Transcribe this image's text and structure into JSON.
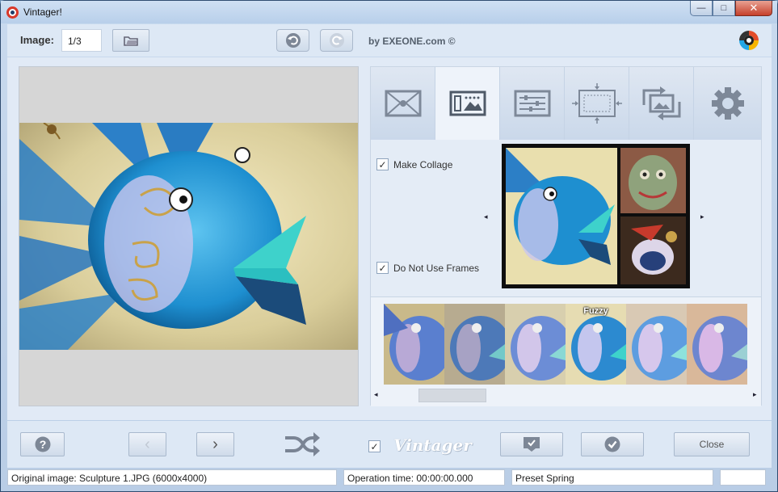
{
  "window": {
    "title": "Vintager!",
    "minimize": "—",
    "maximize": "□",
    "close": "✕"
  },
  "toolbar": {
    "image_label": "Image:",
    "image_value": "1/3",
    "brand_by": "by",
    "brand_name": "EXEONE",
    "brand_suffix": ".com ©"
  },
  "tabs": [
    {
      "name": "frames",
      "icon": "envelope-frame-icon",
      "active": false
    },
    {
      "name": "collage",
      "icon": "collage-icon",
      "active": true
    },
    {
      "name": "adjustments",
      "icon": "sliders-icon",
      "active": false
    },
    {
      "name": "resize",
      "icon": "resize-icon",
      "active": false
    },
    {
      "name": "rotate",
      "icon": "rotate-image-icon",
      "active": false
    },
    {
      "name": "settings",
      "icon": "gear-icon",
      "active": false
    }
  ],
  "collage_options": {
    "make_collage_label": "Make Collage",
    "make_collage_checked": true,
    "no_frames_label": "Do Not Use Frames",
    "no_frames_checked": true,
    "prev_arrow": "◂",
    "next_arrow": "▸"
  },
  "filters": [
    {
      "label": ""
    },
    {
      "label": ""
    },
    {
      "label": ""
    },
    {
      "label": "Fuzzy"
    },
    {
      "label": ""
    },
    {
      "label": ""
    }
  ],
  "scroll": {
    "left": "◂",
    "right": "▸"
  },
  "bottom": {
    "help": "?",
    "prev": "‹",
    "next": "›",
    "vintager_checked": true,
    "vintager_logo": "Vintager",
    "close_label": "Close"
  },
  "status": {
    "original": "Original image: Sculpture 1.JPG (6000x4000)",
    "operation": "Operation time: 00:00:00.000",
    "preset": "Preset Spring",
    "extra": ""
  },
  "colors": {
    "accent": "#3a6fb0",
    "fish_blue": "#2a8fd0",
    "fish_lip": "#3fd0cc"
  }
}
